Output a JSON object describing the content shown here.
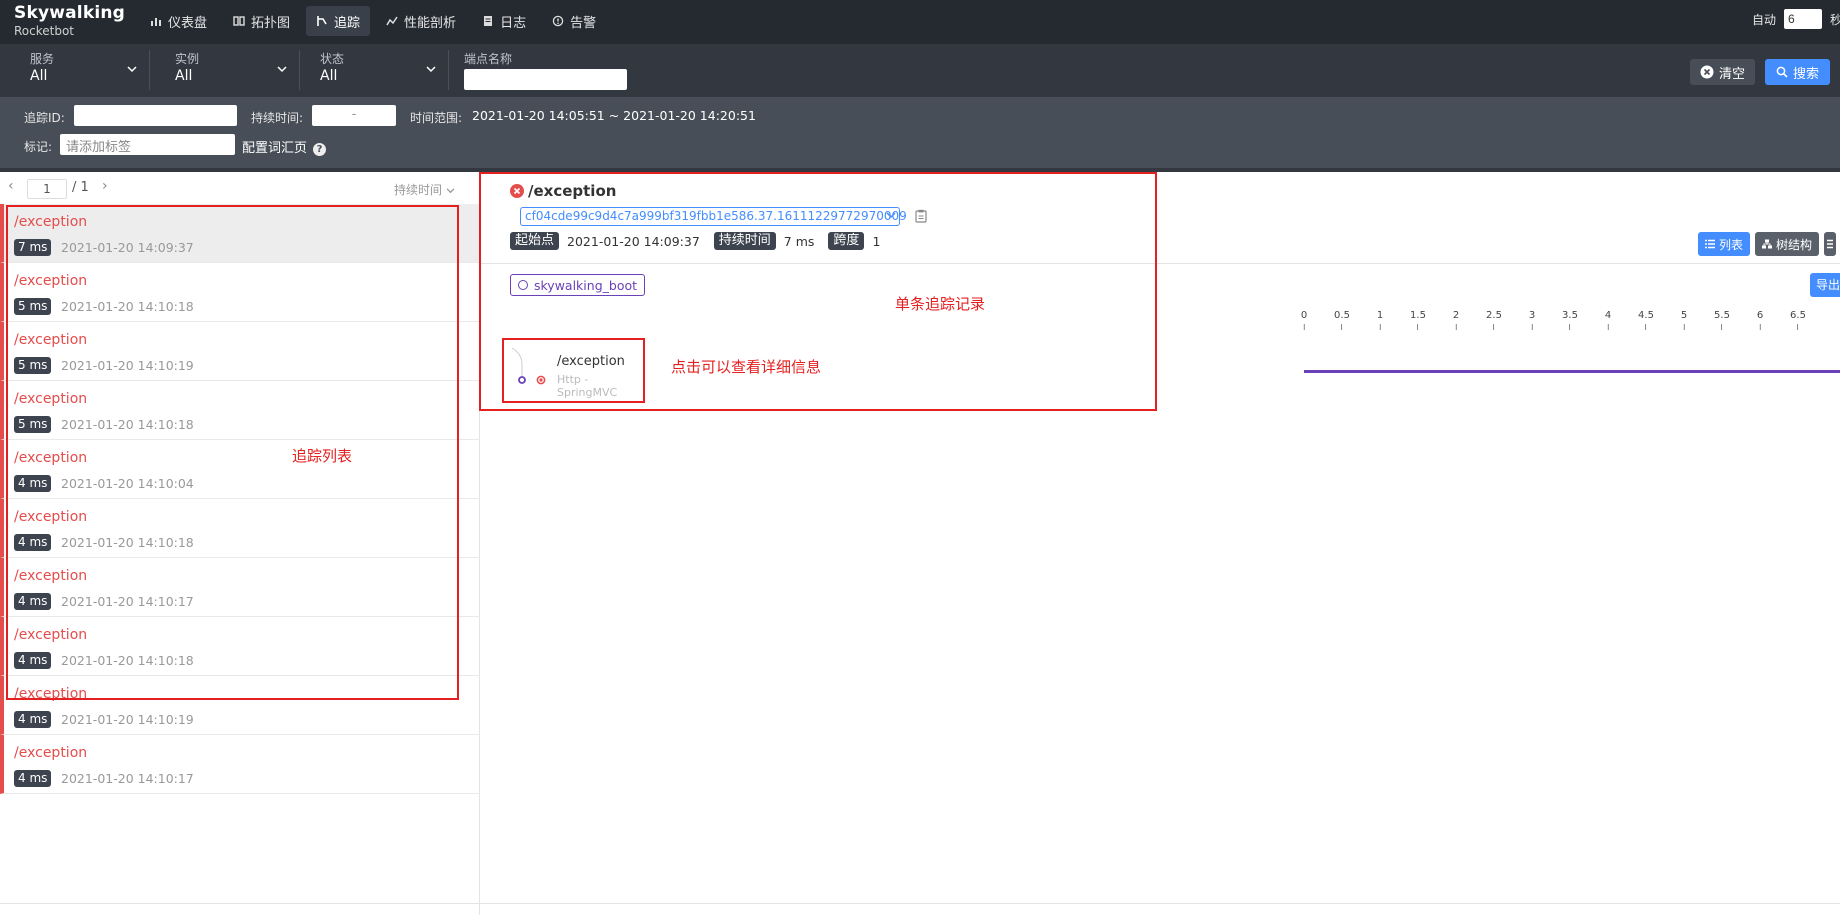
{
  "brand": {
    "title": "Skywalking",
    "subtitle": "Rocketbot"
  },
  "nav": [
    {
      "label": "仪表盘",
      "icon": "dashboard-icon"
    },
    {
      "label": "拓扑图",
      "icon": "topology-icon"
    },
    {
      "label": "追踪",
      "icon": "trace-icon",
      "active": true
    },
    {
      "label": "性能剖析",
      "icon": "profile-icon"
    },
    {
      "label": "日志",
      "icon": "log-icon"
    },
    {
      "label": "告警",
      "icon": "alarm-icon"
    }
  ],
  "auto": {
    "label": "自动",
    "value": "6",
    "unit": "秒"
  },
  "filters": {
    "service": {
      "label": "服务",
      "value": "All"
    },
    "instance": {
      "label": "实例",
      "value": "All"
    },
    "status": {
      "label": "状态",
      "value": "All"
    },
    "endpoint": {
      "label": "端点名称"
    },
    "clear_label": "清空",
    "search_label": "搜索"
  },
  "conditions": {
    "trace_id_label": "追踪ID:",
    "duration_label": "持续时间:",
    "duration_sep": "-",
    "time_range_label": "时间范围:",
    "time_range_value": "2021-01-20 14:05:51 ~ 2021-01-20 14:20:51",
    "tags_label": "标记:",
    "tags_placeholder": "请添加标签",
    "config_label": "配置词汇页"
  },
  "pager": {
    "page": "1",
    "total": "/ 1",
    "sort_label": "持续时间"
  },
  "traces": [
    {
      "endpoint": "/exception",
      "duration": "7 ms",
      "time": "2021-01-20 14:09:37",
      "selected": true
    },
    {
      "endpoint": "/exception",
      "duration": "5 ms",
      "time": "2021-01-20 14:10:18"
    },
    {
      "endpoint": "/exception",
      "duration": "5 ms",
      "time": "2021-01-20 14:10:19"
    },
    {
      "endpoint": "/exception",
      "duration": "5 ms",
      "time": "2021-01-20 14:10:18"
    },
    {
      "endpoint": "/exception",
      "duration": "4 ms",
      "time": "2021-01-20 14:10:04"
    },
    {
      "endpoint": "/exception",
      "duration": "4 ms",
      "time": "2021-01-20 14:10:18"
    },
    {
      "endpoint": "/exception",
      "duration": "4 ms",
      "time": "2021-01-20 14:10:17"
    },
    {
      "endpoint": "/exception",
      "duration": "4 ms",
      "time": "2021-01-20 14:10:18"
    },
    {
      "endpoint": "/exception",
      "duration": "4 ms",
      "time": "2021-01-20 14:10:19"
    },
    {
      "endpoint": "/exception",
      "duration": "4 ms",
      "time": "2021-01-20 14:10:17"
    }
  ],
  "annotations": {
    "list": "追踪列表",
    "single": "单条追踪记录",
    "click": "点击可以查看详细信息"
  },
  "detail": {
    "title": "/exception",
    "trace_id": "cf04cde99c9d4c7a999bf319fbb1e586.37.16111229772970009",
    "start_label": "起始点",
    "start_value": "2021-01-20 14:09:37",
    "duration_label": "持续时间",
    "duration_value": "7 ms",
    "span_label": "跨度",
    "span_value": "1",
    "view_list": "列表",
    "view_tree": "树结构",
    "service": "skywalking_boot",
    "export": "导出",
    "span": {
      "name": "/exception",
      "sub": "Http - SpringMVC"
    },
    "ticks": [
      "0",
      "0.5",
      "1",
      "1.5",
      "2",
      "2.5",
      "3",
      "3.5",
      "4",
      "4.5",
      "5",
      "5.5",
      "6",
      "6.5"
    ]
  },
  "colors": {
    "topbar": "#252a31",
    "accent": "#448dfe",
    "error": "#e54c4c",
    "service": "#6a41b8",
    "annotation": "#e52020"
  }
}
